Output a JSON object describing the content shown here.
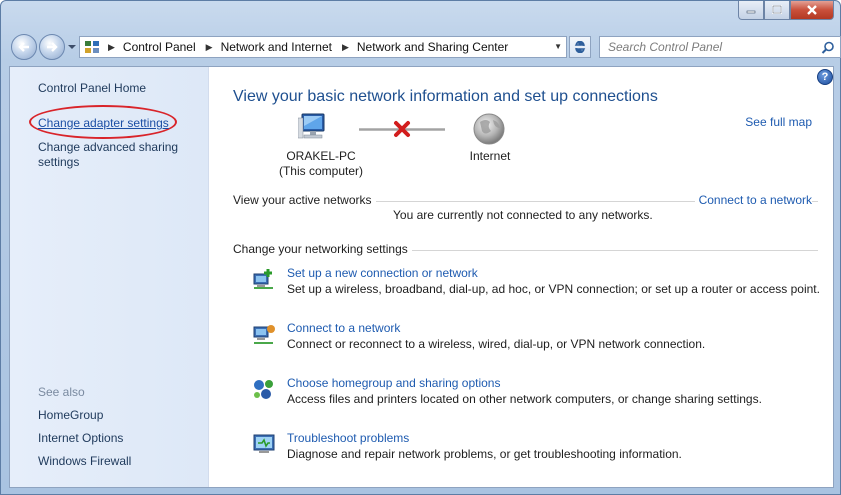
{
  "window": {
    "caption_buttons": [
      {
        "name": "minimize-button",
        "icon": "minimize-icon"
      },
      {
        "name": "maximize-button",
        "icon": "maximize-icon"
      },
      {
        "name": "close-button",
        "icon": "close-icon"
      }
    ]
  },
  "navbar": {
    "breadcrumbs": [
      "Control Panel",
      "Network and Internet",
      "Network and Sharing Center"
    ],
    "search_placeholder": "Search Control Panel"
  },
  "sidebar": {
    "home": "Control Panel Home",
    "links": [
      "Change adapter settings",
      "Change advanced sharing settings"
    ],
    "see_also_title": "See also",
    "see_also": [
      "HomeGroup",
      "Internet Options",
      "Windows Firewall"
    ]
  },
  "main": {
    "title": "View your basic network information and set up connections",
    "see_full_map": "See full map",
    "computer_name": "ORAKEL-PC",
    "computer_sub": "(This computer)",
    "internet_label": "Internet",
    "active_networks_label": "View your active networks",
    "connect_link": "Connect to a network",
    "not_connected_text": "You are currently not connected to any networks.",
    "settings_label": "Change your networking settings",
    "tasks": [
      {
        "icon": "new-connection-icon",
        "link": "Set up a new connection or network",
        "desc": "Set up a wireless, broadband, dial-up, ad hoc, or VPN connection; or set up a router or access point."
      },
      {
        "icon": "connect-network-icon",
        "link": "Connect to a network",
        "desc": "Connect or reconnect to a wireless, wired, dial-up, or VPN network connection."
      },
      {
        "icon": "homegroup-icon",
        "link": "Choose homegroup and sharing options",
        "desc": "Access files and printers located on other network computers, or change sharing settings."
      },
      {
        "icon": "troubleshoot-icon",
        "link": "Troubleshoot problems",
        "desc": "Diagnose and repair network problems, or get troubleshooting information."
      }
    ]
  },
  "colors": {
    "link": "#1e5bb0",
    "heading": "#1e4f8f",
    "highlight_ring": "#d9242a",
    "sidebar_bg": "#e6eefa"
  }
}
